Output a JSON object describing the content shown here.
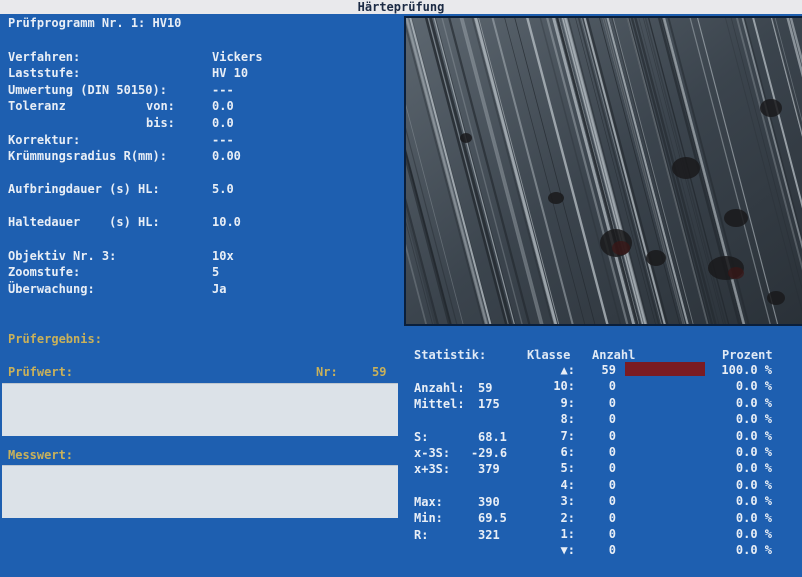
{
  "window": {
    "title": "Härteprüfung"
  },
  "program": {
    "title": "Prüfprogramm Nr. 1: HV10",
    "fields": [
      {
        "label": "Verfahren:",
        "value": "Vickers"
      },
      {
        "label": "Laststufe:",
        "value": "HV 10"
      },
      {
        "label": "Umwertung (DIN 50150):",
        "value": "---"
      },
      {
        "label": "Toleranz",
        "sub": "von:",
        "value": "0.0"
      },
      {
        "label": "",
        "sub": "bis:",
        "value": "0.0"
      },
      {
        "label": "Korrektur:",
        "value": "---"
      },
      {
        "label": "Krümmungsradius R(mm):",
        "value": "0.00"
      },
      {
        "label": "Aufbringdauer (s) HL:",
        "value": "5.0"
      },
      {
        "label": "Haltedauer    (s) HL:",
        "value": "10.0"
      },
      {
        "label": "Objektiv Nr. 3:",
        "value": "10x"
      },
      {
        "label": "Zoomstufe:",
        "value": "5"
      },
      {
        "label": "Überwachung:",
        "value": "Ja"
      }
    ]
  },
  "result": {
    "heading": "Prüfergebnis:",
    "pruefwert_label": "Prüfwert:",
    "nr_label": "Nr:",
    "nr_value": "59",
    "pruefwert_value": "",
    "messwert_label": "Messwert:",
    "messwert_value": ""
  },
  "statistics": {
    "heading": "Statistik:",
    "col_klasse": "Klasse",
    "col_anzahl": "Anzahl",
    "col_prozent": "Prozent",
    "summary": [
      {
        "label": "Anzahl:",
        "value": "59"
      },
      {
        "label": "Mittel:",
        "value": "175"
      },
      {
        "label": "S:",
        "value": "68.1"
      },
      {
        "label": "x-3S:",
        "value": "-29.6"
      },
      {
        "label": "x+3S:",
        "value": "379"
      },
      {
        "label": "Max:",
        "value": "390"
      },
      {
        "label": "Min:",
        "value": "69.5"
      },
      {
        "label": "R:",
        "value": "321"
      }
    ],
    "classes": [
      {
        "klasse": "▲:",
        "anzahl": "59",
        "prozent": "100.0 %"
      },
      {
        "klasse": "10:",
        "anzahl": "0",
        "prozent": "0.0 %"
      },
      {
        "klasse": "9:",
        "anzahl": "0",
        "prozent": "0.0 %"
      },
      {
        "klasse": "8:",
        "anzahl": "0",
        "prozent": "0.0 %"
      },
      {
        "klasse": "7:",
        "anzahl": "0",
        "prozent": "0.0 %"
      },
      {
        "klasse": "6:",
        "anzahl": "0",
        "prozent": "0.0 %"
      },
      {
        "klasse": "5:",
        "anzahl": "0",
        "prozent": "0.0 %"
      },
      {
        "klasse": "4:",
        "anzahl": "0",
        "prozent": "0.0 %"
      },
      {
        "klasse": "3:",
        "anzahl": "0",
        "prozent": "0.0 %"
      },
      {
        "klasse": "2:",
        "anzahl": "0",
        "prozent": "0.0 %"
      },
      {
        "klasse": "1:",
        "anzahl": "0",
        "prozent": "0.0 %"
      },
      {
        "klasse": "▼:",
        "anzahl": "0",
        "prozent": "0.0 %"
      }
    ],
    "bar_fraction": 1.0,
    "bar_color": "#7a1b22"
  },
  "colors": {
    "background": "#1e5fb0",
    "accent": "#c9b15a"
  }
}
